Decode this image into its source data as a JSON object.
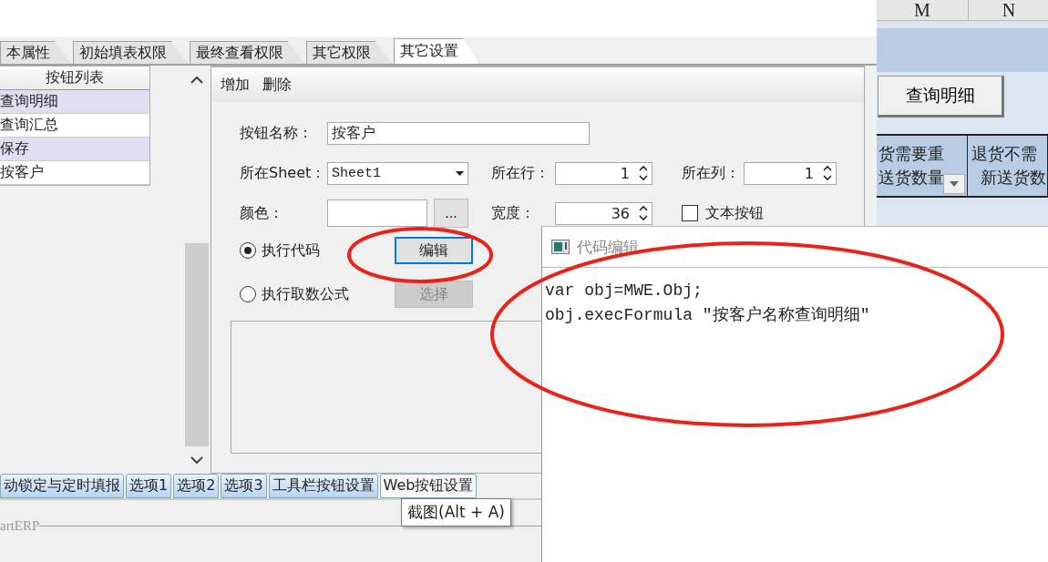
{
  "tabs": [
    {
      "label": "本属性",
      "selected": false
    },
    {
      "label": "初始填表权限",
      "selected": false
    },
    {
      "label": "最终查看权限",
      "selected": false
    },
    {
      "label": "其它权限",
      "selected": false
    },
    {
      "label": "其它设置",
      "selected": true
    }
  ],
  "button_list": {
    "header": "按钮列表",
    "items": [
      {
        "label": "查询明细"
      },
      {
        "label": "查询汇总"
      },
      {
        "label": "保存"
      },
      {
        "label": "按客户"
      }
    ]
  },
  "toolbar": [
    "增加",
    "删除"
  ],
  "form": {
    "name_label": "按钮名称：",
    "name_value": "按客户",
    "sheet_label": "所在Sheet：",
    "sheet_value": "Sheet1",
    "row_label": "所在行：",
    "row_value": "1",
    "col_label": "所在列：",
    "col_value": "1",
    "color_label": "颜色：",
    "color_button": "...",
    "width_label": "宽度：",
    "width_value": "36",
    "text_button": {
      "label": "文本按钮",
      "checked": false
    }
  },
  "actions": [
    {
      "label": "执行代码",
      "selected": true,
      "button": "编辑",
      "disabled": false,
      "focused": true
    },
    {
      "label": "执行取数公式",
      "selected": false,
      "button": "选择",
      "disabled": true,
      "focused": false
    }
  ],
  "bottom_tabs": [
    {
      "label": "动锁定与定时填报",
      "selected": false
    },
    {
      "label": "选项1",
      "selected": false
    },
    {
      "label": "选项2",
      "selected": false
    },
    {
      "label": "选项3",
      "selected": false
    },
    {
      "label": "工具栏按钮设置",
      "selected": false
    },
    {
      "label": "Web按钮设置",
      "selected": true
    }
  ],
  "group_label": "artERP",
  "tooltip": "截图(Alt + A)",
  "sheet": {
    "columns": [
      "M",
      "N"
    ],
    "button": "查询明细",
    "header_cells": [
      [
        "货需要重",
        "送货数量"
      ],
      [
        "退货不需",
        "新送货数"
      ]
    ]
  },
  "editor": {
    "title": "代码编辑",
    "lines": [
      "var obj=MWE.Obj;",
      "obj.execFormula ″按客户名称查询明细″"
    ]
  }
}
